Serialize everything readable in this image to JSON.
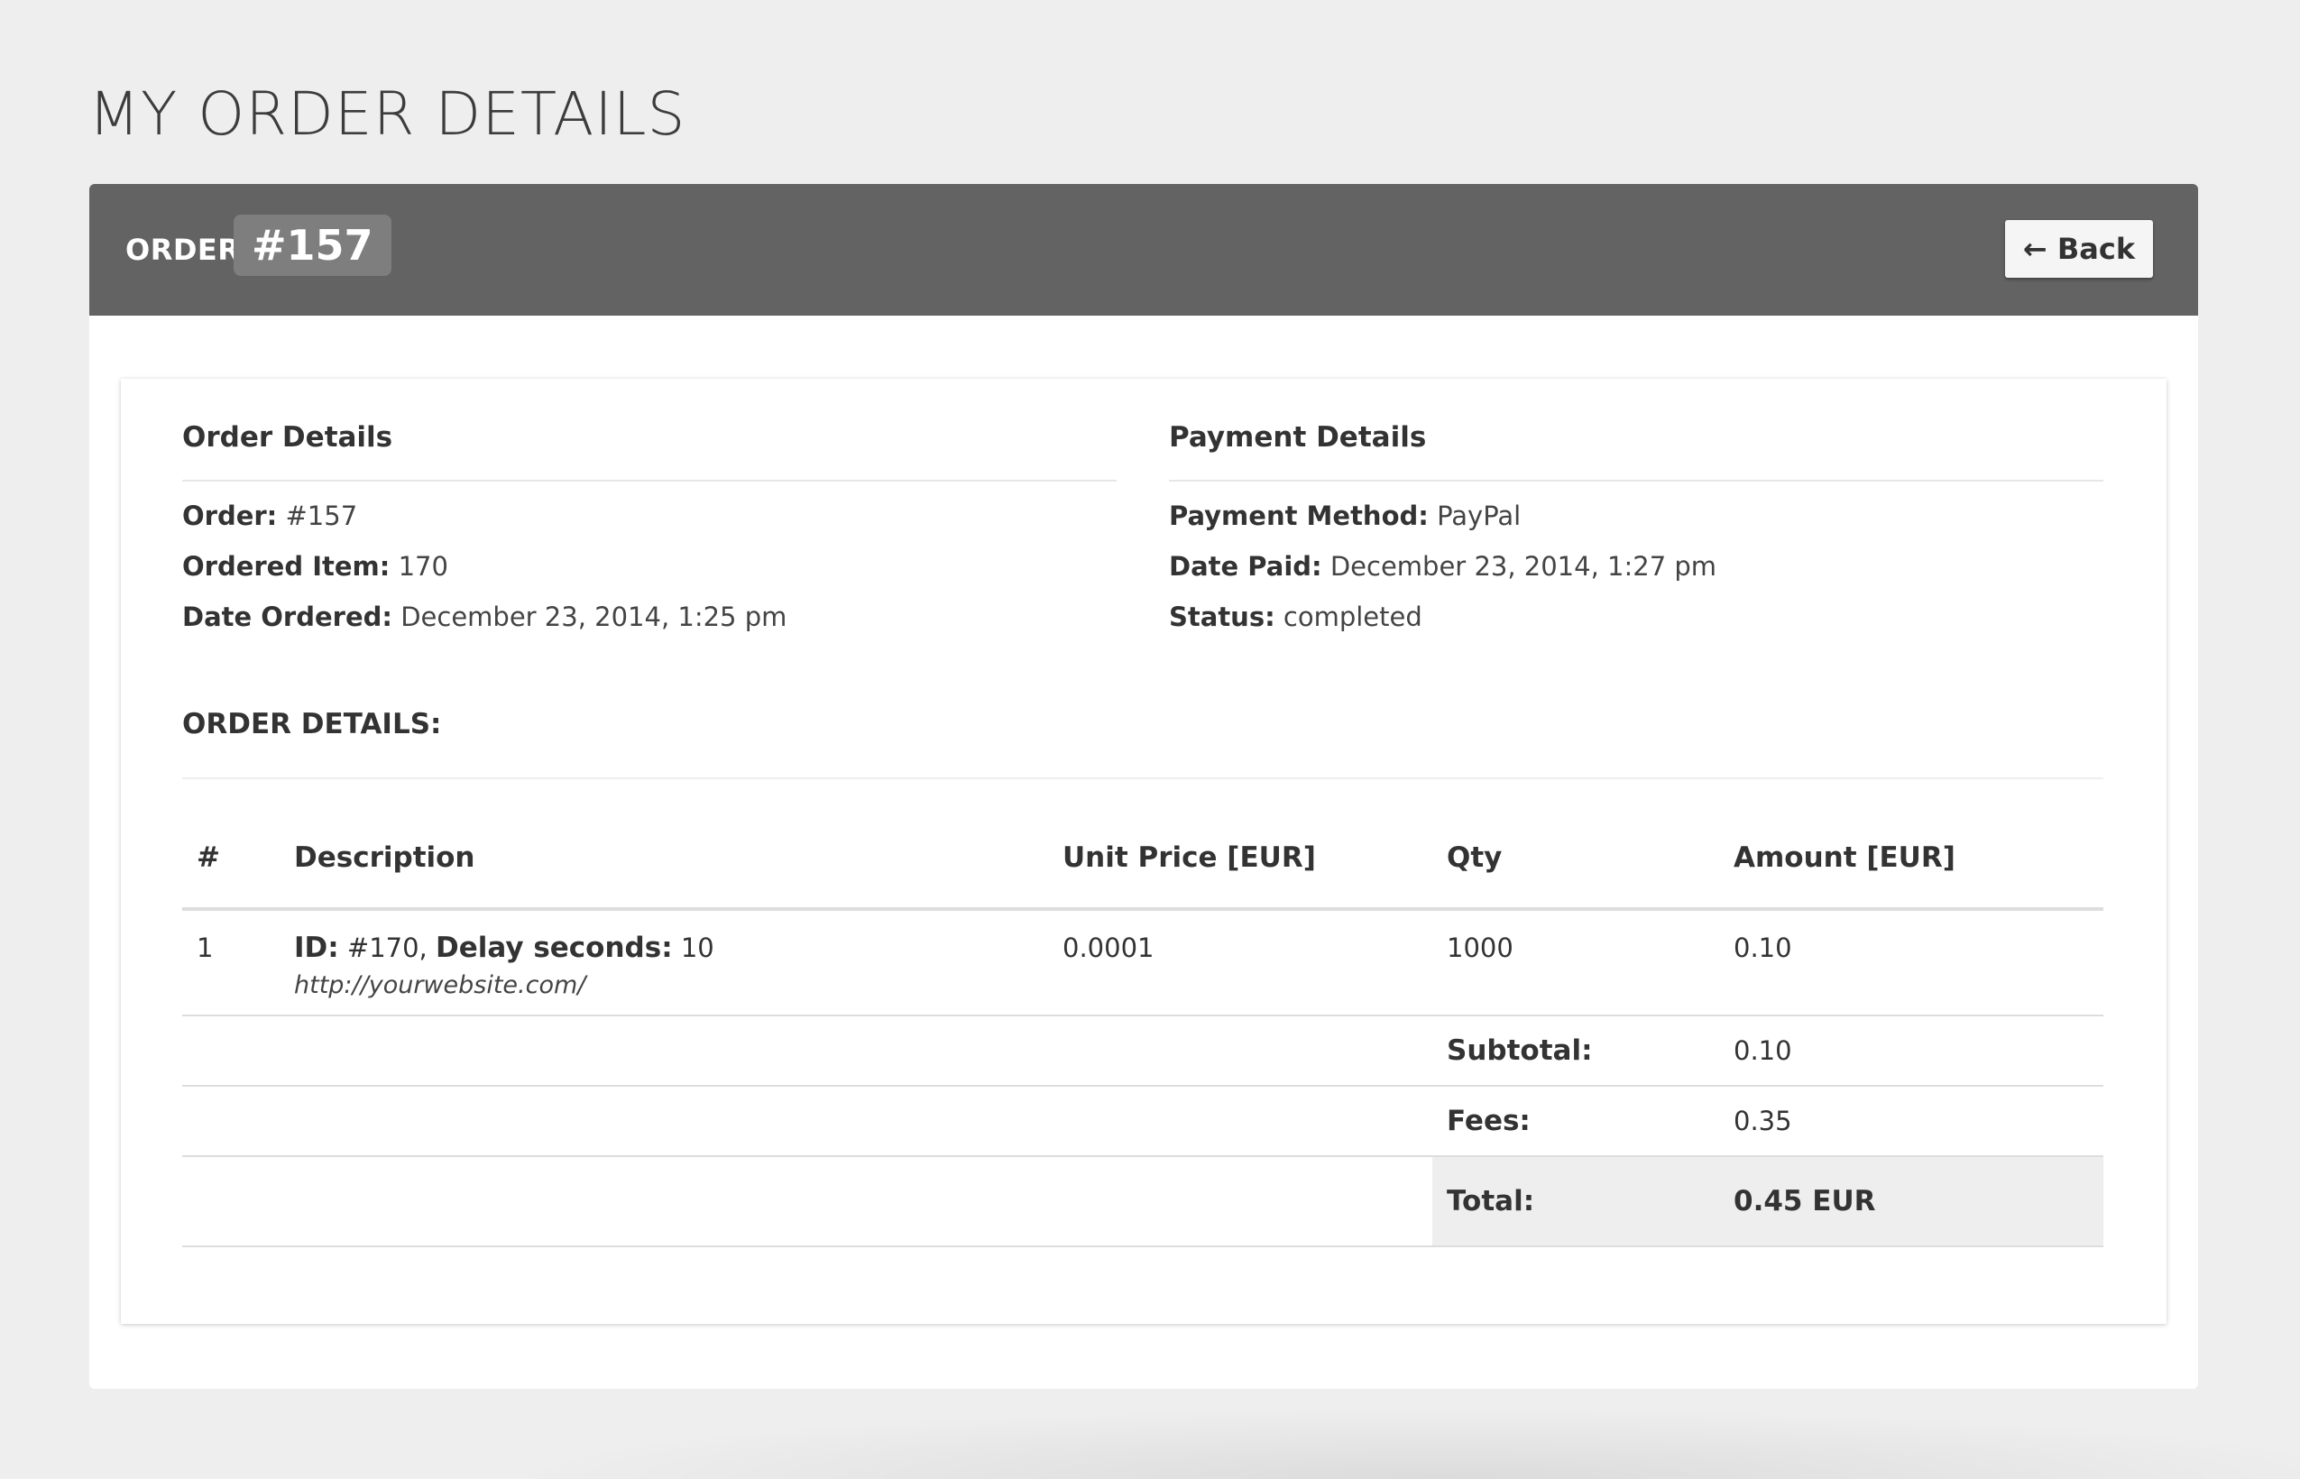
{
  "page": {
    "title": "MY ORDER DETAILS"
  },
  "header": {
    "order_label": "ORDER",
    "order_number": "#157",
    "back_label": "← Back"
  },
  "order_details": {
    "title": "Order Details",
    "fields": [
      {
        "label": "Order:",
        "value": "#157"
      },
      {
        "label": "Ordered Item:",
        "value": "170"
      },
      {
        "label": "Date Ordered:",
        "value": "December 23, 2014, 1:25 pm"
      }
    ]
  },
  "payment_details": {
    "title": "Payment Details",
    "fields": [
      {
        "label": "Payment Method:",
        "value": "PayPal"
      },
      {
        "label": "Date Paid:",
        "value": "December 23, 2014, 1:27 pm"
      },
      {
        "label": "Status:",
        "value": "completed"
      }
    ]
  },
  "items": {
    "heading": "ORDER DETAILS:",
    "columns": [
      "#",
      "Description",
      "Unit Price [EUR]",
      "Qty",
      "Amount [EUR]"
    ],
    "rows": [
      {
        "num": "1",
        "id_label": "ID:",
        "id_value": "#170,",
        "delay_label": "Delay seconds:",
        "delay_value": "10",
        "url": "http://yourwebsite.com/",
        "unit_price": "0.0001",
        "qty": "1000",
        "amount": "0.10"
      }
    ],
    "subtotal_label": "Subtotal:",
    "subtotal_value": "0.10",
    "fees_label": "Fees:",
    "fees_value": "0.35",
    "total_label": "Total:",
    "total_value": "0.45 EUR"
  }
}
